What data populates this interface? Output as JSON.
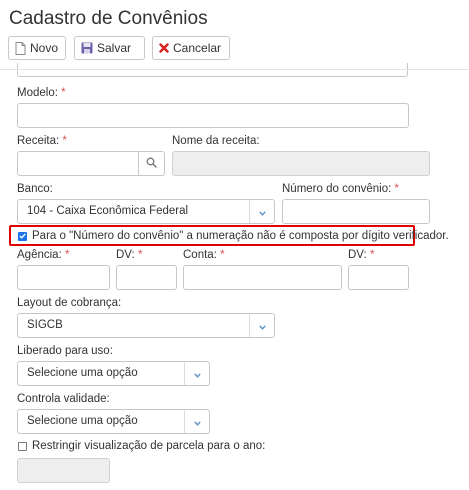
{
  "page": {
    "title": "Cadastro de Convênios"
  },
  "toolbar": {
    "new_label": "Novo",
    "save_label": "Salvar",
    "cancel_label": "Cancelar"
  },
  "form": {
    "modelo": {
      "label": "Modelo:",
      "required": "*",
      "value": ""
    },
    "receita": {
      "label": "Receita:",
      "required": "*",
      "value": ""
    },
    "nome_receita": {
      "label": "Nome da receita:",
      "value": ""
    },
    "banco": {
      "label": "Banco:",
      "selected": "104 - Caixa Econômica Federal"
    },
    "numero_convenio": {
      "label": "Número do convênio:",
      "required": "*",
      "value": ""
    },
    "dv_checkbox": {
      "label": "Para o \"Número do convênio\" a numeração não é composta por dígito verificador.",
      "checked": true
    },
    "agencia": {
      "label": "Agência:",
      "required": "*",
      "value": ""
    },
    "dv_agencia": {
      "label": "DV:",
      "required": "*",
      "value": ""
    },
    "conta": {
      "label": "Conta:",
      "required": "*",
      "value": ""
    },
    "dv_conta": {
      "label": "DV:",
      "required": "*",
      "value": ""
    },
    "layout_cobranca": {
      "label": "Layout de cobrança:",
      "selected": "SIGCB"
    },
    "liberado_uso": {
      "label": "Liberado para uso:",
      "selected": "Selecione uma opção"
    },
    "controla_validade": {
      "label": "Controla validade:",
      "selected": "Selecione uma opção"
    },
    "restringir": {
      "label": "Restringir visualização de parcela para o ano:",
      "checked": false,
      "value": ""
    }
  },
  "colors": {
    "highlight": "#e00000",
    "required": "#d9534f",
    "checkbox": "#1a73e8"
  },
  "icons": [
    "new-document-icon",
    "floppy-disk-icon",
    "close-x-icon",
    "search-icon",
    "chevron-down-icon"
  ]
}
